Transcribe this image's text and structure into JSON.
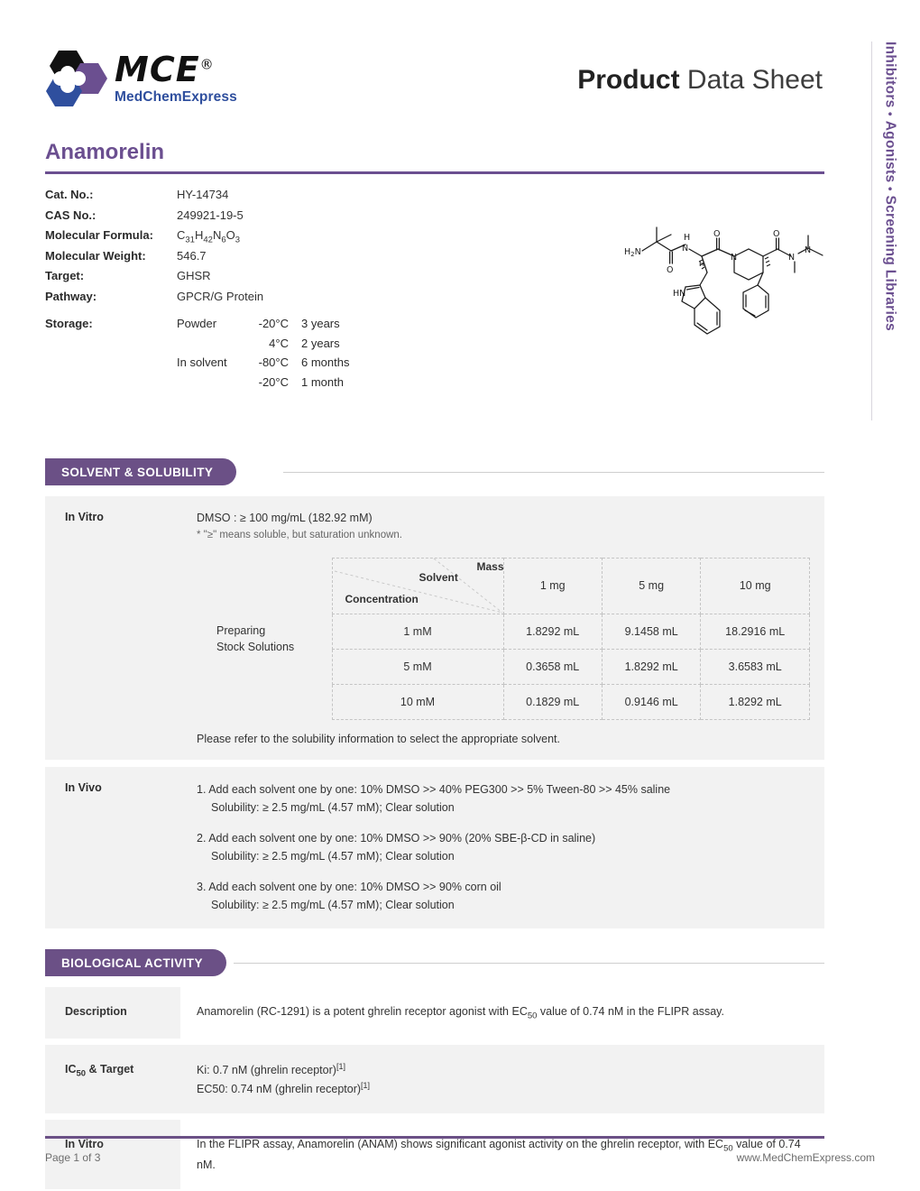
{
  "brand": {
    "name": "MCE",
    "registered": "®",
    "subtitle": "MedChemExpress",
    "logo_icon": "mce-hexagon-logo",
    "colors": {
      "black_hex": "#111111",
      "purple_hex": "#6b4f90",
      "blue_hex": "#2f4f9e"
    }
  },
  "header": {
    "title_bold": "Product",
    "title_rest": " Data Sheet"
  },
  "sidebar": {
    "items": [
      "Inhibitors",
      "Agonists",
      "Screening Libraries"
    ],
    "separator": "•",
    "color_hex": "#6b4f90"
  },
  "product": {
    "name": "Anamorelin",
    "accent_hex": "#6b4f90",
    "properties": [
      {
        "key": "Cat. No.:",
        "value": "HY-14734"
      },
      {
        "key": "CAS No.:",
        "value": "249921-19-5"
      },
      {
        "key": "Molecular Formula:",
        "value": "C31H42N6O3",
        "formula_parts": [
          {
            "t": "C",
            "sub": "31"
          },
          {
            "t": "H",
            "sub": "42"
          },
          {
            "t": "N",
            "sub": "6"
          },
          {
            "t": "O",
            "sub": "3"
          }
        ]
      },
      {
        "key": "Molecular Weight:",
        "value": "546.7"
      },
      {
        "key": "Target:",
        "value": "GHSR"
      },
      {
        "key": "Pathway:",
        "value": "GPCR/G Protein"
      }
    ],
    "storage": {
      "key": "Storage:",
      "rows": [
        {
          "medium": "Powder",
          "temp": "-20°C",
          "duration": "3 years"
        },
        {
          "medium": "",
          "temp": "4°C",
          "duration": "2 years"
        },
        {
          "medium": "In solvent",
          "temp": "-80°C",
          "duration": "6 months"
        },
        {
          "medium": "",
          "temp": "-20°C",
          "duration": "1 month"
        }
      ]
    },
    "structure_alt": "chemical-structure-anamorelin"
  },
  "solvent_section": {
    "badge": "SOLVENT & SOLUBILITY",
    "in_vitro": {
      "label": "In Vitro",
      "solubility": "DMSO : ≥ 100 mg/mL (182.92 mM)",
      "note": "* \"≥\" means soluble, but saturation unknown.",
      "stock_label_line1": "Preparing",
      "stock_label_line2": "Stock Solutions",
      "corner": {
        "mass": "Mass",
        "solvent": "Solvent",
        "concentration": "Concentration"
      },
      "mass_headers": [
        "1 mg",
        "5 mg",
        "10 mg"
      ],
      "rows": [
        {
          "conc": "1 mM",
          "values": [
            "1.8292 mL",
            "9.1458 mL",
            "18.2916 mL"
          ]
        },
        {
          "conc": "5 mM",
          "values": [
            "0.3658 mL",
            "1.8292 mL",
            "3.6583 mL"
          ]
        },
        {
          "conc": "10 mM",
          "values": [
            "0.1829 mL",
            "0.9146 mL",
            "1.8292 mL"
          ]
        }
      ],
      "footer_note": "Please refer to the solubility information to select the appropriate solvent."
    },
    "in_vivo": {
      "label": "In Vivo",
      "items": [
        {
          "recipe": "1. Add each solvent one by one:  10% DMSO  >>  40% PEG300  >>  5% Tween-80  >>  45% saline",
          "solubility": "Solubility: ≥ 2.5 mg/mL (4.57 mM); Clear solution"
        },
        {
          "recipe": "2. Add each solvent one by one:  10% DMSO  >>  90% (20% SBE-β-CD in saline)",
          "solubility": "Solubility: ≥ 2.5 mg/mL (4.57 mM); Clear solution"
        },
        {
          "recipe": "3. Add each solvent one by one:  10% DMSO  >>  90% corn oil",
          "solubility": "Solubility: ≥ 2.5 mg/mL (4.57 mM); Clear solution"
        }
      ]
    }
  },
  "bio_section": {
    "badge": "BIOLOGICAL ACTIVITY",
    "rows": [
      {
        "key": "Description",
        "key_sub": "",
        "lines": [
          "Anamorelin (RC-1291) is a potent ghrelin receptor agonist with EC50 value of 0.74 nM in the FLIPR assay."
        ],
        "pre": "Anamorelin (RC-1291) is a potent ghrelin receptor agonist with EC",
        "sub": "50",
        "post": " value of 0.74 nM in the FLIPR assay."
      },
      {
        "key": "IC50 & Target",
        "key_is_ic50": true,
        "lines": [
          "Ki: 0.7 nM (ghrelin receptor)[1]",
          "EC50: 0.74 nM (ghrelin receptor)[1]"
        ],
        "line1_text": "Ki: 0.7 nM (ghrelin receptor)",
        "line1_ref": "[1]",
        "line2_text": "EC50: 0.74 nM (ghrelin receptor)",
        "line2_ref": "[1]"
      },
      {
        "key": "In Vitro",
        "pre": "In the FLIPR assay, Anamorelin (ANAM) shows significant agonist activity on the ghrelin receptor, with EC",
        "sub": "50",
        "post": " value of 0.74 nM."
      }
    ]
  },
  "footer": {
    "page": "Page  1 of 3",
    "site": "www.MedChemExpress.com",
    "rule_hex": "#6b5086"
  }
}
